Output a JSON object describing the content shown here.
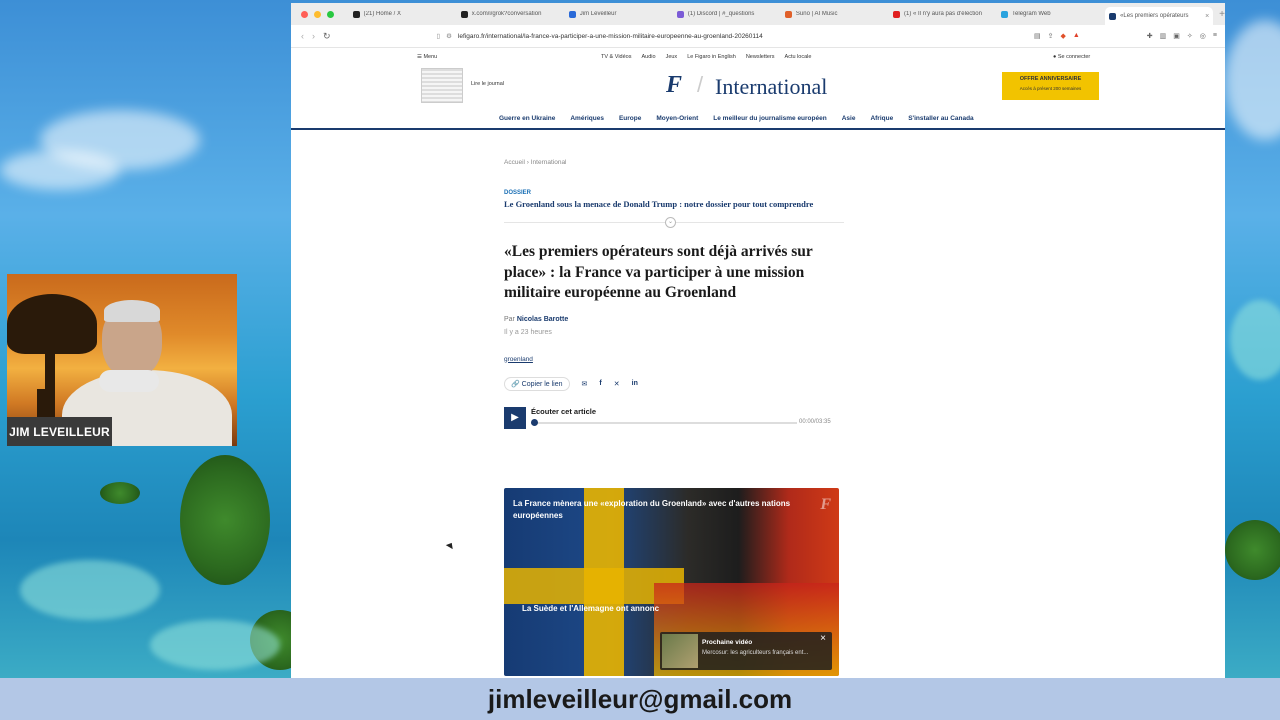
{
  "browser": {
    "tabs": [
      {
        "label": "(21) Home / X",
        "color": "#222222"
      },
      {
        "label": "x.com/i/grok?conversation",
        "color": "#222222"
      },
      {
        "label": "Jim Leveilleur",
        "color": "#2a6ad8"
      },
      {
        "label": "(1) Discord | #_questions",
        "color": "#7b5bd6"
      },
      {
        "label": "Suno | AI Music",
        "color": "#e0602a"
      },
      {
        "label": "(1) « Il n'y aura pas d'élection",
        "color": "#e02020"
      },
      {
        "label": "Telegram Web",
        "color": "#2aa3de"
      },
      {
        "label": "«Les premiers opérateurs",
        "color": "#1a3b6e"
      }
    ],
    "active_tab_close": "×",
    "new_tab": "+",
    "url": "lefigaro.fr/international/la-france-va-participer-a-une-mission-militaire-europeenne-au-groenland-20260114"
  },
  "site": {
    "menu": "Menu",
    "util_links": [
      "TV & Vidéos",
      "Audio",
      "Jeux",
      "Le Figaro in English",
      "Newsletters",
      "Actu locale"
    ],
    "login": "Se connecter",
    "lire_journal": "Lire le journal",
    "logo": "F",
    "section": "International",
    "offer_title": "OFFRE ANNIVERSAIRE",
    "offer_sub": "Accès à présent 200 semaines",
    "nav": [
      "Guerre en Ukraine",
      "Amériques",
      "Europe",
      "Moyen-Orient",
      "Le meilleur du journalisme européen",
      "Asie",
      "Afrique",
      "S'installer au Canada"
    ]
  },
  "article": {
    "breadcrumb": "Accueil  ›  International",
    "dossier_tag": "DOSSIER",
    "dossier_link": "Le Groenland sous la menace de Donald Trump : notre dossier pour tout comprendre",
    "headline": "«Les premiers opérateurs sont déjà arrivés sur place» : la France va participer à une mission militaire européenne au Groenland",
    "by_prefix": "Par",
    "author": "Nicolas Barotte",
    "time": "Il y a 23 heures",
    "topic": "groenland",
    "copy_link": "Copier le lien",
    "listen_label": "Écouter cet article",
    "listen_time": "00:00/03:35",
    "listen_progress": 0
  },
  "video": {
    "title": "La France mènera une «exploration du Groenland» avec d'autres nations européennes",
    "subtitle": "La Suède et l'Allemagne ont annonc",
    "next_label": "Prochaine vidéo",
    "next_text": "Mercosur: les agriculteurs français ent..."
  },
  "overlay": {
    "name_tag": "JIM LEVEILLEUR",
    "email": "jimleveilleur@gmail.com"
  }
}
